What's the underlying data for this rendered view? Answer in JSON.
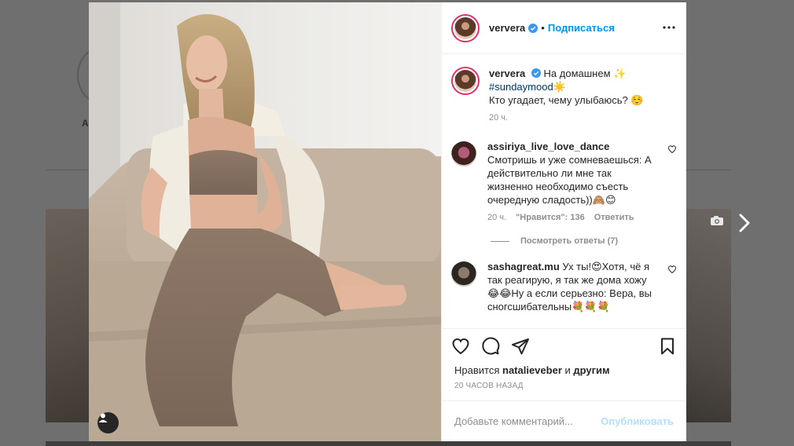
{
  "colors": {
    "accent": "#0095f6",
    "publish_disabled": "#b2dffc",
    "story_ring": "#e1306c",
    "text_primary": "#262626",
    "text_secondary": "#8e8e8e",
    "hashtag": "#00376b",
    "verified": "#3897f0"
  },
  "background": {
    "profile_name_initial": "A"
  },
  "post": {
    "author": "ververa",
    "follow_label": "Подписаться",
    "separator": "•",
    "caption": {
      "username": "ververa",
      "line1": "На домашнем ✨",
      "hashtag": "#sundaymood",
      "hashtag_emoji": "☀️",
      "line2": "Кто угадает, чему улыбаюсь? ☺️",
      "time": "20 ч."
    },
    "comments": [
      {
        "username": "assiriya_live_love_dance",
        "text": "Смотришь и уже сомневаешься: А действительно ли мне так жизненно необходимо съесть очередную сладость))🙈😊",
        "time": "20 ч.",
        "likes": "\"Нравится\": 136",
        "reply_label": "Ответить",
        "view_replies": "Посмотреть ответы (7)"
      },
      {
        "username": "sashagreat.mu",
        "text": "Ух ты!😍Хотя, чё я так реагирую, я так же дома хожу😂😂Ну а если серьезно: Вера, вы сногсшибательны💐💐💐"
      }
    ],
    "likes_prefix": "Нравится",
    "likes_user": "natalieveber",
    "likes_and": "и",
    "likes_others": "другим",
    "timestamp": "20 ЧАСОВ НАЗАД",
    "comment_placeholder": "Добавьте комментарий...",
    "publish_label": "Опубликовать"
  },
  "icons": {
    "verified": "verified-badge-icon",
    "more": "more-options-icon",
    "heart": "heart-icon",
    "comment": "comment-icon",
    "share": "share-icon",
    "save": "bookmark-icon",
    "tag": "user-tag-icon",
    "camera": "camera-icon",
    "next": "chevron-right-icon"
  }
}
